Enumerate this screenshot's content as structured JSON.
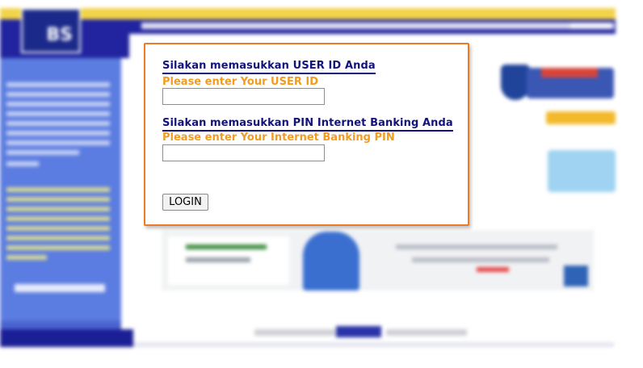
{
  "login": {
    "user_id_heading": "Silakan memasukkan USER ID Anda",
    "user_id_subheading": "Please enter Your USER ID",
    "user_id_value": "",
    "pin_heading": "Silakan memasukkan PIN Internet Banking Anda",
    "pin_subheading": "Please enter Your Internet Banking PIN",
    "pin_value": "",
    "login_button": "LOGIN"
  },
  "header": {
    "logo_text": "BS"
  },
  "colors": {
    "accent_orange": "#ec7a26",
    "heading_navy": "#12137c",
    "subheading_orange": "#f39b1f",
    "brand_blue": "#21249e",
    "brand_yellow": "#f2d44a"
  },
  "icons": {
    "logo": "bank-logo-icon",
    "shield": "shield-icon"
  }
}
